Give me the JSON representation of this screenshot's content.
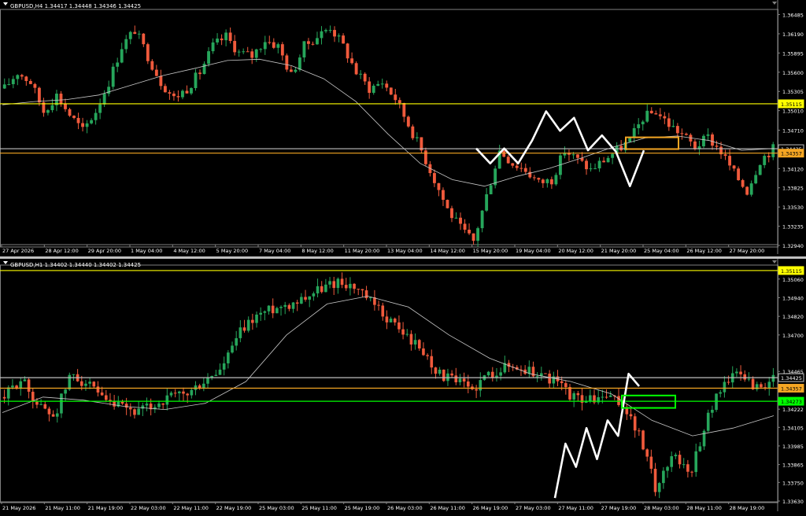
{
  "colors": {
    "background": "#000000",
    "bull": "#26a65b",
    "bear": "#f05a3c",
    "ma": "#c8c8c8",
    "axis_text": "#ffffff",
    "grid_frame": "#808080",
    "resistance": "#ffff00",
    "orange_level": "#f5a623",
    "green_level": "#00ff00",
    "pattern": "#ffffff"
  },
  "chart_data": [
    {
      "type": "candlestick",
      "header": "GBPUSD,H4  1.34417 1.34448 1.34346 1.34425",
      "ylim": [
        1.3294,
        1.3654
      ],
      "ticks": {
        "y": [
          "1.36485",
          "1.36190",
          "1.35895",
          "1.35600",
          "1.35305",
          "1.35010",
          "1.34710",
          "1.34120",
          "1.33825",
          "1.33530",
          "1.33235",
          "1.32940"
        ],
        "x": [
          "27 Apr 2026",
          "28 Apr 12:00",
          "29 Apr 20:00",
          "1 May 04:00",
          "4 May 12:00",
          "5 May 20:00",
          "7 May 04:00",
          "8 May 12:00",
          "11 May 20:00",
          "13 May 04:00",
          "14 May 12:00",
          "15 May 20:00",
          "19 May 04:00",
          "20 May 12:00",
          "21 May 20:00",
          "25 May 04:00",
          "26 May 12:00",
          "27 May 20:00"
        ]
      },
      "levels": [
        {
          "label": "1.35115",
          "value": 1.35115,
          "color": "#ffff00"
        },
        {
          "label": "1.34425",
          "value": 1.34425,
          "color": "#c0c0c0"
        },
        {
          "label": "1.34357",
          "value": 1.34357,
          "color": "#f5a623"
        }
      ],
      "series": [
        {
          "name": "price_path_approx",
          "values": [
            1.3535,
            1.356,
            1.3545,
            1.35,
            1.3525,
            1.3495,
            1.347,
            1.35,
            1.3545,
            1.36,
            1.3625,
            1.3585,
            1.3545,
            1.352,
            1.3535,
            1.356,
            1.36,
            1.3615,
            1.359,
            1.3585,
            1.361,
            1.36,
            1.3555,
            1.36,
            1.3615,
            1.363,
            1.36,
            1.356,
            1.3535,
            1.3545,
            1.352,
            1.348,
            1.344,
            1.3395,
            1.335,
            1.332,
            1.33,
            1.337,
            1.344,
            1.342,
            1.341,
            1.339,
            1.3395,
            1.344,
            1.3425,
            1.341,
            1.3425,
            1.344,
            1.3455,
            1.349,
            1.35,
            1.348,
            1.3465,
            1.3445,
            1.346,
            1.3438,
            1.3405,
            1.3378,
            1.3425,
            1.3443
          ]
        },
        {
          "name": "moving_average",
          "values": [
            1.351,
            1.3515,
            1.3518,
            1.3525,
            1.354,
            1.3555,
            1.3566,
            1.3578,
            1.358,
            1.357,
            1.355,
            1.3515,
            1.3465,
            1.342,
            1.3395,
            1.3385,
            1.34,
            1.3412,
            1.3428,
            1.3445,
            1.3459,
            1.3462,
            1.3455,
            1.344,
            1.3443
          ]
        }
      ],
      "annotations": [
        {
          "kind": "box",
          "color": "#f5a623",
          "label": ""
        },
        {
          "kind": "zigzag",
          "color": "#ffffff",
          "points": [
            1.3443,
            1.342,
            1.3443,
            1.342,
            1.3455,
            1.35,
            1.347,
            1.349,
            1.344,
            1.3463,
            1.3438,
            1.3385,
            1.344
          ]
        }
      ]
    },
    {
      "type": "candlestick",
      "header": "GBPUSD,H1  1.34402 1.34440 1.34402 1.34425",
      "ylim": [
        1.3363,
        1.3514
      ],
      "ticks": {
        "y": [
          "1.35060",
          "1.34940",
          "1.34820",
          "1.34700",
          "1.34465",
          "1.34222",
          "1.34105",
          "1.33985",
          "1.33865",
          "1.33750",
          "1.33630"
        ],
        "x": [
          "21 May 2026",
          "21 May 11:00",
          "21 May 19:00",
          "22 May 03:00",
          "22 May 11:00",
          "22 May 19:00",
          "25 May 03:00",
          "25 May 11:00",
          "25 May 19:00",
          "26 May 03:00",
          "26 May 11:00",
          "26 May 19:00",
          "27 May 03:00",
          "27 May 11:00",
          "27 May 19:00",
          "28 May 03:00",
          "28 May 11:00",
          "28 May 19:00"
        ]
      },
      "levels": [
        {
          "label": "1.35115",
          "value": 1.35115,
          "color": "#ffff00"
        },
        {
          "label": "1.34425",
          "value": 1.34425,
          "color": "#c0c0c0"
        },
        {
          "label": "1.34357",
          "value": 1.34357,
          "color": "#f5a623"
        },
        {
          "label": "1.34273",
          "value": 1.34273,
          "color": "#00ff00"
        }
      ],
      "series": [
        {
          "name": "price_path_approx",
          "values": [
            1.343,
            1.3442,
            1.3425,
            1.3418,
            1.3445,
            1.3438,
            1.3426,
            1.3423,
            1.342,
            1.3425,
            1.343,
            1.3432,
            1.344,
            1.3448,
            1.347,
            1.3482,
            1.3487,
            1.349,
            1.3495,
            1.35,
            1.3505,
            1.35,
            1.349,
            1.348,
            1.347,
            1.346,
            1.3445,
            1.344,
            1.3435,
            1.3445,
            1.345,
            1.3448,
            1.3445,
            1.344,
            1.343,
            1.3428,
            1.343,
            1.3425,
            1.3405,
            1.337,
            1.3395,
            1.338,
            1.3415,
            1.344,
            1.3445,
            1.3436,
            1.3441
          ]
        },
        {
          "name": "moving_average",
          "values": [
            1.342,
            1.343,
            1.3428,
            1.3424,
            1.3422,
            1.3426,
            1.344,
            1.347,
            1.349,
            1.3495,
            1.3488,
            1.347,
            1.3455,
            1.3445,
            1.344,
            1.3432,
            1.3415,
            1.3405,
            1.341,
            1.3418
          ]
        }
      ],
      "annotations": [
        {
          "kind": "box",
          "color": "#00ff00",
          "label": ""
        },
        {
          "kind": "zigzag",
          "color": "#ffffff",
          "points": [
            1.3365,
            1.34,
            1.3385,
            1.341,
            1.339,
            1.3415,
            1.3405,
            1.3445,
            1.3437
          ]
        }
      ]
    }
  ]
}
